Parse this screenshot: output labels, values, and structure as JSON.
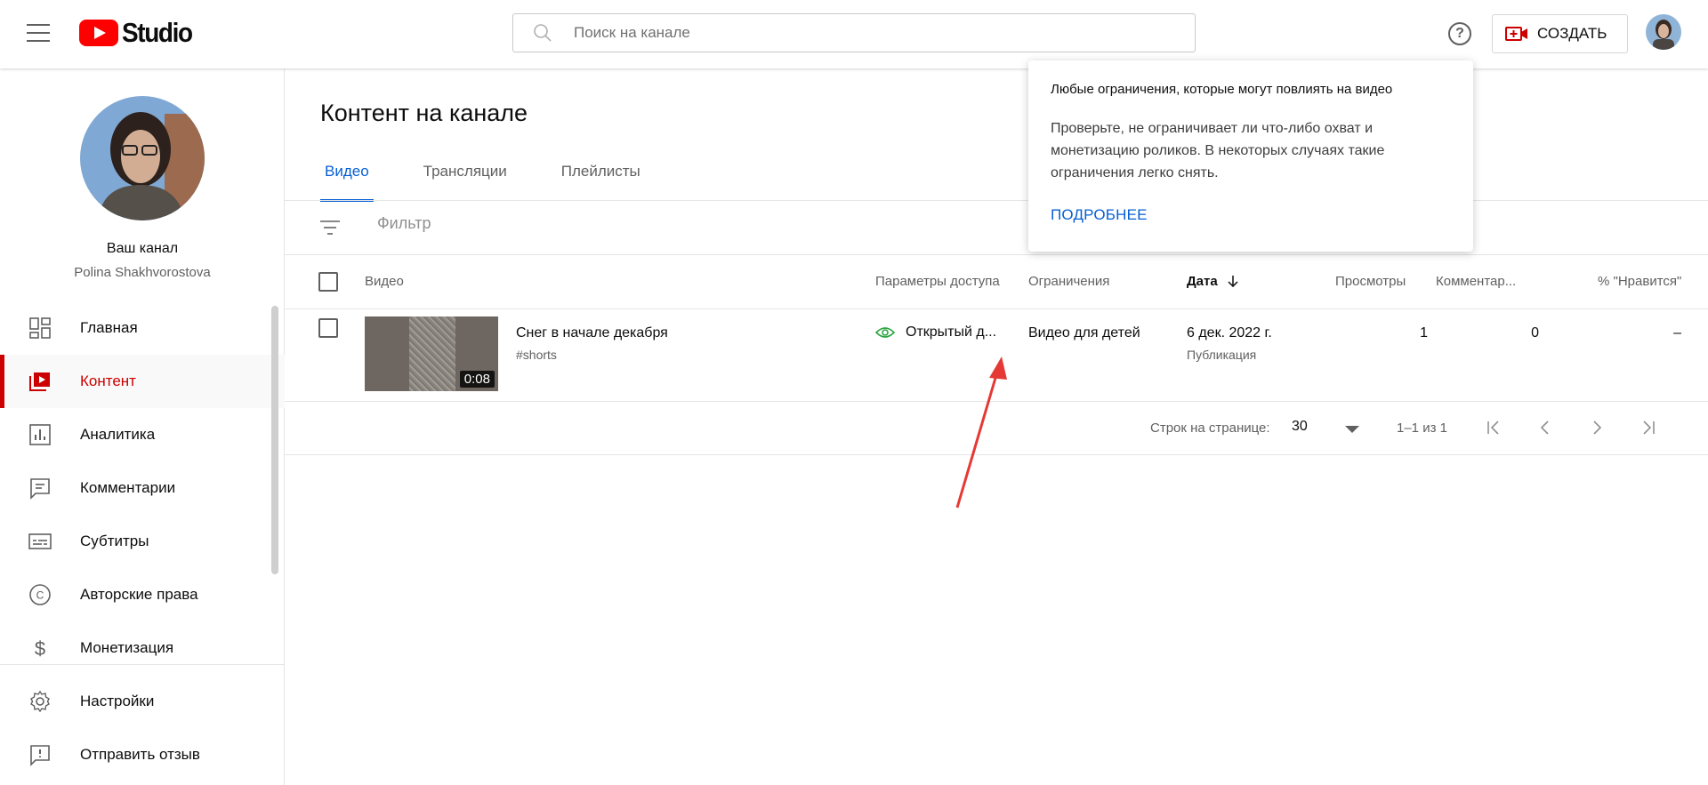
{
  "header": {
    "logo_text": "Studio",
    "search_placeholder": "Поиск на канале",
    "help_label": "?",
    "create_label": "СОЗДАТЬ"
  },
  "sidebar": {
    "channel_title": "Ваш канал",
    "channel_name": "Polina Shakhvorostova",
    "items": [
      {
        "label": "Главная",
        "icon": "dashboard-icon"
      },
      {
        "label": "Контент",
        "icon": "content-icon",
        "active": true
      },
      {
        "label": "Аналитика",
        "icon": "analytics-icon"
      },
      {
        "label": "Комментарии",
        "icon": "comments-icon"
      },
      {
        "label": "Субтитры",
        "icon": "subtitles-icon"
      },
      {
        "label": "Авторские права",
        "icon": "copyright-icon"
      },
      {
        "label": "Монетизация",
        "icon": "monetization-icon"
      }
    ],
    "bottom_items": [
      {
        "label": "Настройки",
        "icon": "gear-icon"
      },
      {
        "label": "Отправить отзыв",
        "icon": "feedback-icon"
      }
    ]
  },
  "main": {
    "title": "Контент на канале",
    "tabs": [
      {
        "label": "Видео",
        "active": true
      },
      {
        "label": "Трансляции"
      },
      {
        "label": "Плейлисты"
      }
    ],
    "filter_placeholder": "Фильтр",
    "columns": {
      "video": "Видео",
      "visibility": "Параметры доступа",
      "restrictions": "Ограничения",
      "date": "Дата",
      "views": "Просмотры",
      "comments": "Комментар...",
      "likes": "% \"Нравится\""
    },
    "rows": [
      {
        "duration": "0:08",
        "title": "Снег в начале декабря",
        "description": "#shorts",
        "visibility": "Открытый д...",
        "restrictions": "Видео для детей",
        "date": "6 дек. 2022 г.",
        "date_status": "Публикация",
        "views": "1",
        "comments": "0",
        "likes": "–"
      }
    ],
    "pagination": {
      "rows_per_page_label": "Строк на странице:",
      "rows_per_page_value": "30",
      "range": "1–1 из 1"
    }
  },
  "tooltip": {
    "title": "Любые ограничения, которые могут повлиять на видео",
    "body": "Проверьте, не ограничивает ли что-либо охват и монетизацию роликов. В некоторых случаях такие ограничения легко снять.",
    "link": "ПОДРОБНЕЕ"
  },
  "colors": {
    "accent_red": "#cc0000",
    "link_blue": "#065fd4",
    "visibility_green": "#2ba640",
    "annotation_arrow": "#e53935"
  }
}
